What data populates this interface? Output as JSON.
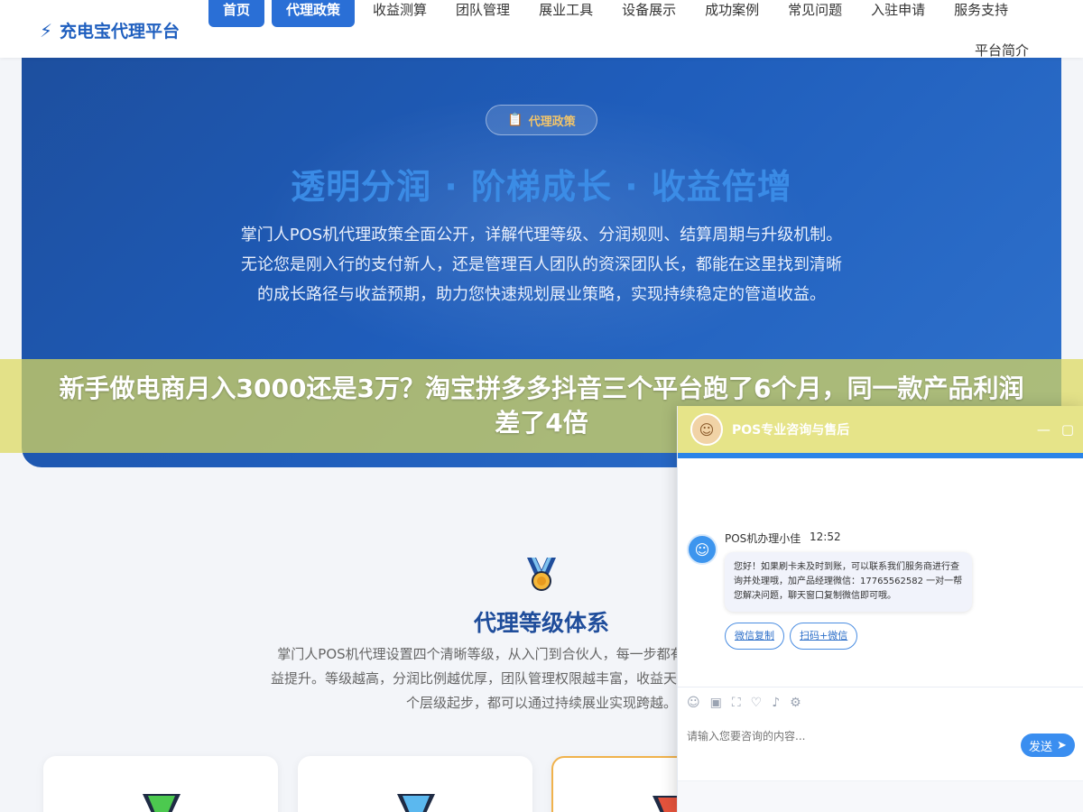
{
  "header": {
    "logo_icon": "⚡",
    "logo_text": "充电宝代理平台",
    "nav": [
      {
        "label": "首页"
      },
      {
        "label": "代理政策"
      },
      {
        "label": "收益测算"
      },
      {
        "label": "团队管理"
      },
      {
        "label": "展业工具"
      },
      {
        "label": "设备展示"
      },
      {
        "label": "成功案例"
      },
      {
        "label": "常见问题"
      },
      {
        "label": "入驻申请"
      },
      {
        "label": "服务支持"
      }
    ],
    "nav_second": "平台简介"
  },
  "hero": {
    "tag_icon": "📋",
    "tag_label": "代理政策",
    "title": "透明分润 · 阶梯成长 · 收益倍增",
    "description": "掌门人POS机代理政策全面公开，详解代理等级、分润规则、结算周期与升级机制。无论您是刚入行的支付新人，还是管理百人团队的资深团队长，都能在这里找到清晰的成长路径与收益预期，助力您快速规划展业策略，实现持续稳定的管道收益。"
  },
  "overlay": {
    "text": "新手做电商月入3000还是3万？淘宝拼多多抖音三个平台跑了6个月，同一款产品利润差了4倍"
  },
  "levels": {
    "title": "代理等级体系",
    "description": "掌门人POS机代理设置四个清晰等级，从入门到合伙人，每一步都有明确的升级条件和权益提升。等级越高，分润比例越优厚，团队管理权限越丰富，收益天花板越高。无论您从哪个层级起步，都可以通过持续展业实现跨越。"
  },
  "chat": {
    "title": "POS专业咨询与售后",
    "minimize": "—",
    "maximize": "▢",
    "sender": "POS机办理小佳",
    "time": "12:52",
    "message": "您好！如果刷卡未及时到账，可以联系我们服务商进行查询并处理哦，加产品经理微信：17765562582 一对一帮您解决问题，聊天窗口复制微信即可哦。",
    "quick_buttons": [
      "微信复制",
      "扫码+微信"
    ],
    "input_placeholder": "请输入您要咨询的内容...",
    "send_label": "发送",
    "send_icon": "➤",
    "colors": {
      "accent": "#3a8ef0",
      "header": "#2a6fd6"
    }
  }
}
